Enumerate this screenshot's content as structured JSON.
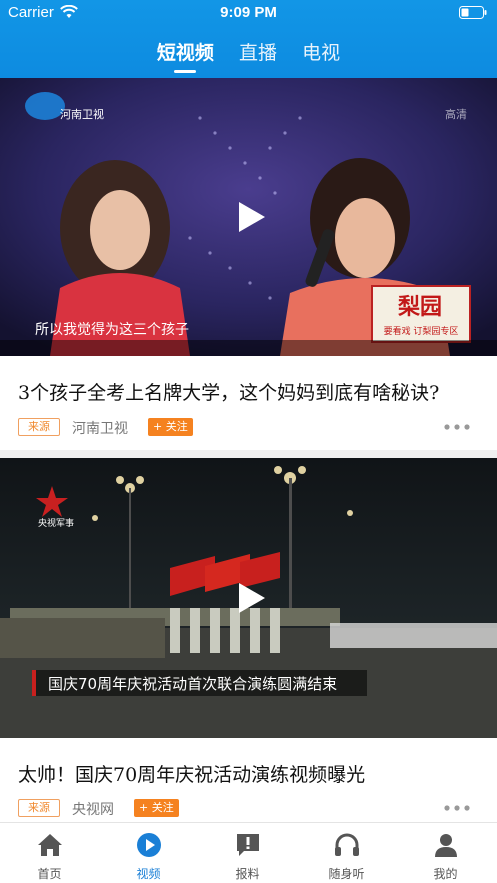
{
  "status_bar": {
    "carrier": "Carrier",
    "time": "9:09 PM"
  },
  "tabs": [
    {
      "label": "短视频",
      "active": true
    },
    {
      "label": "直播",
      "active": false
    },
    {
      "label": "电视",
      "active": false
    }
  ],
  "videos": [
    {
      "title": "3个孩子全考上名牌大学，这个妈妈到底有啥秘诀?",
      "source_badge": "来源",
      "source": "河南卫视",
      "follow": "+ 关注",
      "overlay": {
        "channel_logo_text": "河南卫视",
        "corner_text": "高清",
        "subtitle": "所以我觉得为这三个孩子",
        "banner_big": "梨园",
        "banner_small": "要看戏 订梨园专区"
      }
    },
    {
      "title": "太帅！国庆70周年庆祝活动演练视频曝光",
      "source_badge": "来源",
      "source": "央视网",
      "follow": "+ 关注",
      "overlay": {
        "channel_logo_text": "央视军事",
        "subtitle": "国庆70周年庆祝活动首次联合演练圆满结束"
      }
    }
  ],
  "bottom_nav": [
    {
      "label": "首页",
      "icon": "home-icon",
      "active": false
    },
    {
      "label": "视频",
      "icon": "play-circle-icon",
      "active": true
    },
    {
      "label": "报料",
      "icon": "report-icon",
      "active": false
    },
    {
      "label": "随身听",
      "icon": "headphones-icon",
      "active": false
    },
    {
      "label": "我的",
      "icon": "profile-icon",
      "active": false
    }
  ],
  "colors": {
    "header": "#0d8be0",
    "accent": "#1a7fd6",
    "follow": "#f58220"
  }
}
